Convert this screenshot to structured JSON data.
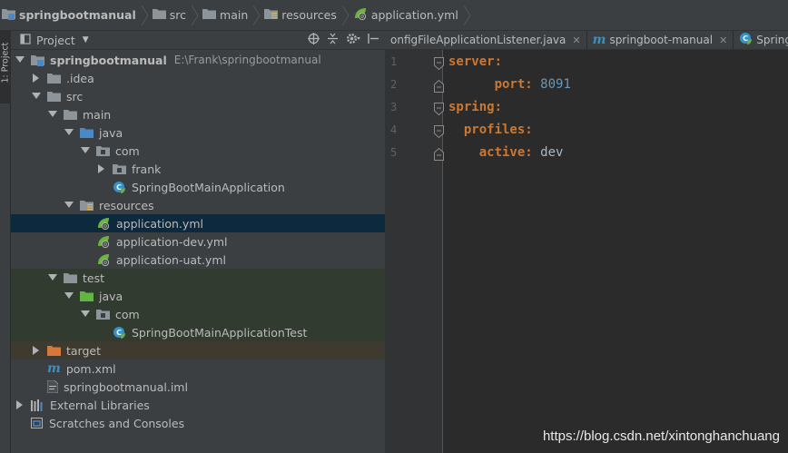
{
  "breadcrumb": [
    {
      "label": "springbootmanual",
      "icon": "module-folder-icon"
    },
    {
      "label": "src",
      "icon": "folder-icon"
    },
    {
      "label": "main",
      "icon": "folder-icon"
    },
    {
      "label": "resources",
      "icon": "resources-folder-icon"
    },
    {
      "label": "application.yml",
      "icon": "spring-yml-icon"
    }
  ],
  "side_tab": {
    "label": "1: Project"
  },
  "project_panel": {
    "title": "Project",
    "tools": [
      "target-icon",
      "collapse-icon",
      "gear-icon",
      "hide-icon"
    ]
  },
  "tree": [
    {
      "label": "springbootmanual",
      "path": "E:\\Frank\\springbootmanual",
      "depth": 0,
      "arrow": "open",
      "icon": "module-folder-icon"
    },
    {
      "label": ".idea",
      "depth": 1,
      "arrow": "closed",
      "icon": "folder-icon"
    },
    {
      "label": "src",
      "depth": 1,
      "arrow": "open",
      "icon": "folder-icon"
    },
    {
      "label": "main",
      "depth": 2,
      "arrow": "open",
      "icon": "folder-icon"
    },
    {
      "label": "java",
      "depth": 3,
      "arrow": "open",
      "icon": "source-folder-icon"
    },
    {
      "label": "com",
      "depth": 4,
      "arrow": "open",
      "icon": "package-icon"
    },
    {
      "label": "frank",
      "depth": 5,
      "arrow": "closed",
      "icon": "package-icon"
    },
    {
      "label": "SpringBootMainApplication",
      "depth": 5,
      "arrow": "none",
      "icon": "spring-class-icon"
    },
    {
      "label": "resources",
      "depth": 3,
      "arrow": "open",
      "icon": "resources-folder-icon"
    },
    {
      "label": "application.yml",
      "depth": 4,
      "arrow": "none",
      "icon": "spring-yml-icon"
    },
    {
      "label": "application-dev.yml",
      "depth": 4,
      "arrow": "none",
      "icon": "spring-yml-icon"
    },
    {
      "label": "application-uat.yml",
      "depth": 4,
      "arrow": "none",
      "icon": "spring-yml-icon"
    },
    {
      "label": "test",
      "depth": 2,
      "arrow": "open",
      "icon": "folder-icon"
    },
    {
      "label": "java",
      "depth": 3,
      "arrow": "open",
      "icon": "test-source-folder-icon"
    },
    {
      "label": "com",
      "depth": 4,
      "arrow": "open",
      "icon": "package-icon"
    },
    {
      "label": "SpringBootMainApplicationTest",
      "depth": 5,
      "arrow": "none",
      "icon": "spring-class-icon"
    },
    {
      "label": "target",
      "depth": 1,
      "arrow": "closed",
      "icon": "excluded-folder-icon"
    },
    {
      "label": "pom.xml",
      "depth": 1,
      "arrow": "none",
      "icon": "maven-icon"
    },
    {
      "label": "springbootmanual.iml",
      "depth": 1,
      "arrow": "none",
      "icon": "iml-file-icon"
    },
    {
      "label": "External Libraries",
      "depth": 0,
      "arrow": "closed",
      "icon": "libraries-icon"
    },
    {
      "label": "Scratches and Consoles",
      "depth": 0,
      "arrow": "none",
      "icon": "scratches-icon"
    }
  ],
  "selected_item": "application.yml",
  "editor_tabs": [
    {
      "label": "onfigFileApplicationListener.java",
      "icon": "none"
    },
    {
      "label": "springboot-manual",
      "icon": "maven-icon"
    },
    {
      "label": "SpringBootMa",
      "icon": "spring-class-icon"
    }
  ],
  "editor": {
    "lines": [
      {
        "num": "1",
        "indent": "",
        "key": "server:",
        "value": ""
      },
      {
        "num": "2",
        "indent": "      ",
        "key": "port:",
        "value": " 8091"
      },
      {
        "num": "3",
        "indent": "",
        "key": "spring:",
        "value": ""
      },
      {
        "num": "4",
        "indent": "  ",
        "key": "profiles:",
        "value": ""
      },
      {
        "num": "5",
        "indent": "    ",
        "key": "active:",
        "value": " dev"
      }
    ]
  },
  "watermark": "https://blog.csdn.net/xintonghanchuang",
  "colors": {
    "background": "#2b2b2b",
    "panel": "#3c3f41",
    "selection": "#0d293e",
    "yaml_key": "#cc7832",
    "yaml_number": "#6897bb",
    "yaml_text": "#a9b7c6"
  }
}
